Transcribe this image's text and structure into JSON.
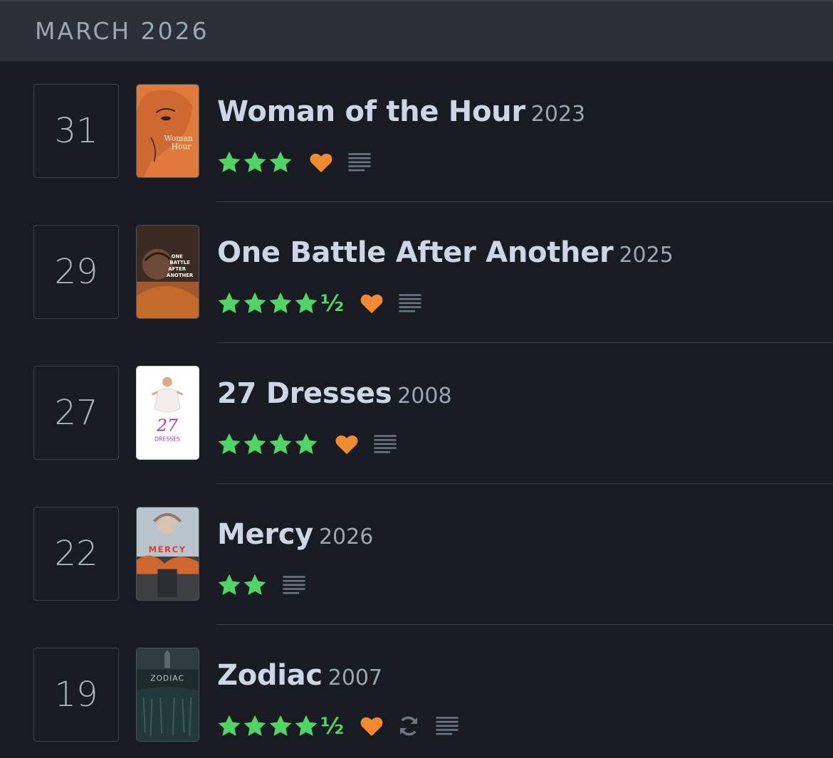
{
  "month": "MARCH 2026",
  "colors": {
    "star": "#4fd564",
    "heart": "#f28b30",
    "icon_muted": "#6b7684"
  },
  "entries": [
    {
      "day": "31",
      "title": "Woman of the Hour",
      "year": "2023",
      "rating": 3,
      "half_star": false,
      "liked": true,
      "rewatch": false,
      "has_review": true,
      "poster_text": [
        "Woman",
        "Hour"
      ]
    },
    {
      "day": "29",
      "title": "One Battle After Another",
      "year": "2025",
      "rating": 4.5,
      "half_star": true,
      "liked": true,
      "rewatch": false,
      "has_review": true,
      "poster_text": [
        "ONE",
        "BATTLE",
        "AFTER",
        "ANOTHER"
      ]
    },
    {
      "day": "27",
      "title": "27 Dresses",
      "year": "2008",
      "rating": 4,
      "half_star": false,
      "liked": true,
      "rewatch": false,
      "has_review": true,
      "poster_text": [
        "27",
        "DRESSES"
      ]
    },
    {
      "day": "22",
      "title": "Mercy",
      "year": "2026",
      "rating": 2,
      "half_star": false,
      "liked": false,
      "rewatch": false,
      "has_review": true,
      "poster_text": [
        "MERCY"
      ]
    },
    {
      "day": "19",
      "title": "Zodiac",
      "year": "2007",
      "rating": 4.5,
      "half_star": true,
      "liked": true,
      "rewatch": true,
      "has_review": true,
      "poster_text": [
        "ZODIAC"
      ]
    }
  ],
  "half_glyph": "½",
  "icons": {
    "star": "star-icon",
    "heart": "heart-icon",
    "rewatch": "rewatch-icon",
    "review": "review-lines-icon"
  }
}
